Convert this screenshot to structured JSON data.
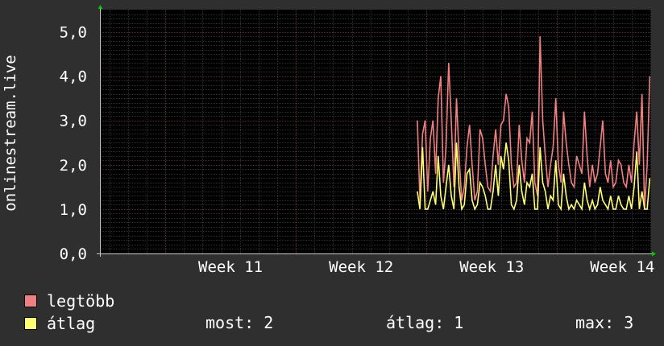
{
  "chart_data": {
    "type": "line",
    "ylabel": "onlinestream.live",
    "ylim": [
      0,
      5.5
    ],
    "yticks": [
      {
        "value": 0,
        "label": "0,0"
      },
      {
        "value": 1,
        "label": "1,0"
      },
      {
        "value": 2,
        "label": "2,0"
      },
      {
        "value": 3,
        "label": "3,0"
      },
      {
        "value": 4,
        "label": "4,0"
      },
      {
        "value": 5,
        "label": "5,0"
      }
    ],
    "x_range_weeks": [
      10.5,
      14.72
    ],
    "x_ticks": [
      {
        "value": 11,
        "label": "Week 11"
      },
      {
        "value": 12,
        "label": "Week 12"
      },
      {
        "value": 13,
        "label": "Week 13"
      },
      {
        "value": 14,
        "label": "Week 14"
      }
    ],
    "grid": true,
    "legend_placement": "bottom-left",
    "series": [
      {
        "name": "legtöbb",
        "color": "#f08080",
        "x": [
          12.93,
          12.95,
          12.97,
          12.99,
          13.01,
          13.03,
          13.05,
          13.07,
          13.09,
          13.11,
          13.13,
          13.15,
          13.17,
          13.19,
          13.21,
          13.23,
          13.25,
          13.27,
          13.29,
          13.31,
          13.33,
          13.35,
          13.37,
          13.39,
          13.41,
          13.43,
          13.45,
          13.47,
          13.49,
          13.51,
          13.53,
          13.55,
          13.57,
          13.59,
          13.61,
          13.63,
          13.65,
          13.67,
          13.69,
          13.71,
          13.73,
          13.75,
          13.77,
          13.79,
          13.81,
          13.83,
          13.85,
          13.87,
          13.89,
          13.91,
          13.93,
          13.95,
          13.97,
          13.99,
          14.01,
          14.03,
          14.05,
          14.07,
          14.09,
          14.11,
          14.13,
          14.15,
          14.17,
          14.19,
          14.21,
          14.23,
          14.25,
          14.27,
          14.29,
          14.31,
          14.33,
          14.35,
          14.37,
          14.39,
          14.41,
          14.43,
          14.45,
          14.47,
          14.49,
          14.51,
          14.53,
          14.55,
          14.57,
          14.59,
          14.61,
          14.63,
          14.65,
          14.67,
          14.69,
          14.71
        ],
        "y": [
          3.0,
          1.2,
          2.7,
          3.0,
          1.4,
          2.6,
          3.0,
          1.8,
          3.5,
          4.0,
          1.6,
          2.4,
          4.3,
          3.0,
          1.5,
          3.5,
          2.2,
          1.2,
          1.5,
          2.4,
          2.9,
          2.0,
          1.2,
          1.4,
          2.8,
          2.6,
          2.0,
          1.5,
          1.4,
          2.2,
          2.8,
          2.0,
          2.9,
          3.0,
          3.6,
          3.3,
          2.0,
          1.5,
          1.6,
          2.9,
          2.1,
          1.6,
          2.6,
          2.5,
          3.2,
          1.6,
          1.3,
          4.9,
          3.0,
          2.2,
          1.5,
          2.0,
          2.4,
          3.5,
          2.0,
          1.6,
          3.2,
          2.5,
          2.0,
          1.6,
          1.5,
          2.2,
          2.0,
          1.8,
          3.2,
          2.2,
          1.5,
          2.0,
          1.6,
          1.8,
          2.4,
          3.0,
          1.8,
          1.6,
          2.1,
          1.5,
          1.6,
          2.1,
          2.0,
          1.6,
          1.5,
          2.0,
          1.6,
          2.5,
          3.2,
          2.0,
          3.6,
          1.0,
          2.0,
          4.0
        ]
      },
      {
        "name": "átlag",
        "color": "#ffff70",
        "x": [
          12.93,
          12.95,
          12.97,
          12.99,
          13.01,
          13.03,
          13.05,
          13.07,
          13.09,
          13.11,
          13.13,
          13.15,
          13.17,
          13.19,
          13.21,
          13.23,
          13.25,
          13.27,
          13.29,
          13.31,
          13.33,
          13.35,
          13.37,
          13.39,
          13.41,
          13.43,
          13.45,
          13.47,
          13.49,
          13.51,
          13.53,
          13.55,
          13.57,
          13.59,
          13.61,
          13.63,
          13.65,
          13.67,
          13.69,
          13.71,
          13.73,
          13.75,
          13.77,
          13.79,
          13.81,
          13.83,
          13.85,
          13.87,
          13.89,
          13.91,
          13.93,
          13.95,
          13.97,
          13.99,
          14.01,
          14.03,
          14.05,
          14.07,
          14.09,
          14.11,
          14.13,
          14.15,
          14.17,
          14.19,
          14.21,
          14.23,
          14.25,
          14.27,
          14.29,
          14.31,
          14.33,
          14.35,
          14.37,
          14.39,
          14.41,
          14.43,
          14.45,
          14.47,
          14.49,
          14.51,
          14.53,
          14.55,
          14.57,
          14.59,
          14.61,
          14.63,
          14.65,
          14.67,
          14.69,
          14.71
        ],
        "y": [
          1.4,
          1.0,
          2.4,
          1.0,
          1.0,
          1.2,
          1.4,
          1.1,
          2.2,
          1.3,
          1.0,
          1.5,
          2.0,
          1.3,
          1.0,
          2.5,
          1.5,
          1.0,
          1.1,
          1.8,
          1.9,
          1.2,
          1.0,
          1.1,
          1.6,
          1.5,
          1.3,
          1.0,
          1.0,
          1.4,
          2.0,
          1.3,
          2.2,
          1.9,
          2.5,
          2.1,
          1.1,
          1.0,
          1.2,
          2.0,
          1.4,
          1.1,
          1.6,
          1.5,
          1.8,
          1.0,
          1.0,
          2.4,
          1.6,
          1.4,
          1.0,
          1.3,
          1.2,
          2.1,
          1.1,
          1.0,
          1.8,
          1.3,
          1.0,
          1.1,
          1.0,
          1.2,
          1.1,
          1.0,
          1.6,
          1.2,
          1.0,
          1.2,
          1.0,
          1.1,
          1.5,
          1.2,
          1.1,
          1.0,
          1.3,
          1.0,
          1.0,
          1.3,
          1.1,
          1.0,
          1.0,
          1.3,
          1.0,
          1.5,
          2.3,
          1.0,
          1.4,
          1.0,
          1.0,
          1.7
        ]
      }
    ]
  },
  "legend": {
    "items": [
      {
        "label": "legtöbb",
        "color": "#f08080"
      },
      {
        "label": "átlag",
        "color": "#ffff70"
      }
    ],
    "stats": {
      "most": "most: 2",
      "atlag": "átlag: 1",
      "max": "max: 3"
    }
  }
}
